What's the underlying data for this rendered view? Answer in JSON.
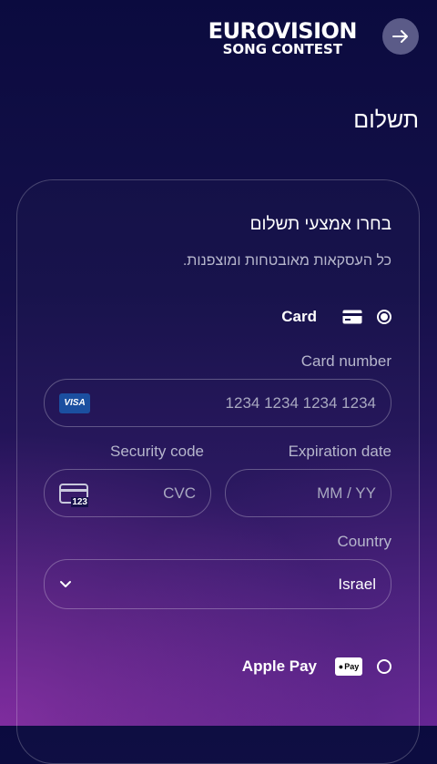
{
  "header": {
    "logo_line1": "EUROVISION",
    "logo_line2": "SONG CONTEST",
    "next_icon": "arrow-right-icon"
  },
  "page": {
    "title": "תשלום"
  },
  "payment": {
    "title": "בחרו אמצעי תשלום",
    "subtitle": "כל העסקאות מאובטחות ומוצפנות.",
    "card_option": {
      "label": "Card",
      "selected": true,
      "icon": "credit-card-icon"
    },
    "card_number": {
      "label": "Card number",
      "placeholder": "1234 1234 1234 1234",
      "brand": "VISA"
    },
    "expiration": {
      "label": "Expiration date",
      "placeholder": "MM / YY"
    },
    "security": {
      "label": "Security code",
      "placeholder": "CVC",
      "icon_text": "123"
    },
    "country": {
      "label": "Country",
      "value": "Israel"
    },
    "applepay_option": {
      "label": "Apple Pay",
      "selected": false,
      "badge": "Pay"
    }
  },
  "colors": {
    "background_top": "#0b0b3f",
    "background_bottom": "#4b1f7c",
    "brand_visa": "#1b4fa0"
  }
}
